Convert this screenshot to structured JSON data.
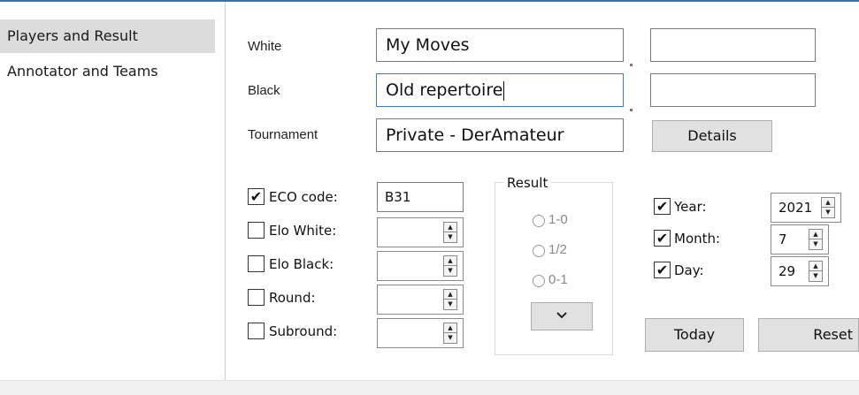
{
  "sidebar": {
    "items": [
      {
        "label": "Players and Result",
        "active": true
      },
      {
        "label": "Annotator and Teams",
        "active": false
      }
    ]
  },
  "form": {
    "white_label": "White",
    "white_value": "My Moves",
    "white_extra": "",
    "black_label": "Black",
    "black_value": "Old repertoire",
    "black_extra": "",
    "tournament_label": "Tournament",
    "tournament_value": "Private - DerAmateur",
    "details_button": "Details",
    "eco_label": "ECO code:",
    "eco_checked": true,
    "eco_value": "B31",
    "elo_white_label": "Elo White:",
    "elo_white_checked": false,
    "elo_white_value": "",
    "elo_black_label": "Elo Black:",
    "elo_black_checked": false,
    "elo_black_value": "",
    "round_label": "Round:",
    "round_checked": false,
    "round_value": "",
    "subround_label": "Subround:",
    "subround_checked": false,
    "subround_value": "",
    "result": {
      "title": "Result",
      "options": [
        "1-0",
        "1/2",
        "0-1"
      ],
      "dropdown_value": "",
      "dropdown_icon": "chevron-down-icon"
    },
    "year_label": "Year:",
    "year_checked": true,
    "year_value": "2021",
    "month_label": "Month:",
    "month_checked": true,
    "month_value": "7",
    "day_label": "Day:",
    "day_checked": true,
    "day_value": "29",
    "today_button": "Today",
    "reset_button": "Reset"
  },
  "glyphs": {
    "check": "✔",
    "up": "▲",
    "down": "▼",
    "chevron": "⌄"
  },
  "colors": {
    "accent_line": "#3a6fb0",
    "focus_border": "#3a7bd5",
    "sidebar_active": "#dcdcdc",
    "button_bg": "#e1e1e1"
  }
}
